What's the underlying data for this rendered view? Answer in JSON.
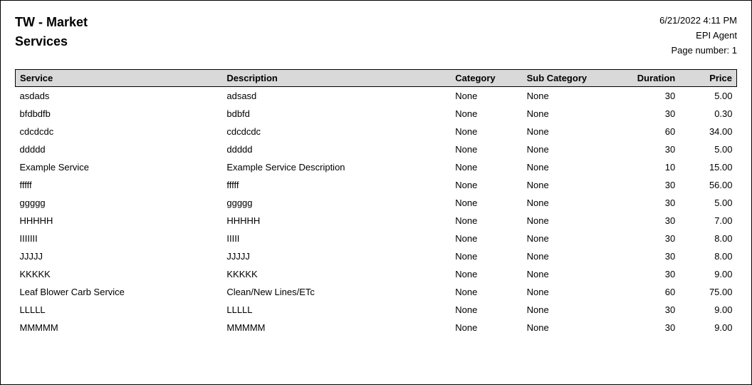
{
  "header": {
    "title_line1": "TW - Market",
    "title_line2": "Services",
    "datetime": "6/21/2022 4:11 PM",
    "agent": "EPI Agent",
    "page_label": "Page number: 1"
  },
  "table": {
    "columns": {
      "service": "Service",
      "description": "Description",
      "category": "Category",
      "subcategory": "Sub Category",
      "duration": "Duration",
      "price": "Price"
    },
    "rows": [
      {
        "service": "asdads",
        "description": "adsasd",
        "category": "None",
        "subcategory": "None",
        "duration": "30",
        "price": "5.00"
      },
      {
        "service": "bfdbdfb",
        "description": "bdbfd",
        "category": "None",
        "subcategory": "None",
        "duration": "30",
        "price": "0.30"
      },
      {
        "service": "cdcdcdc",
        "description": "cdcdcdc",
        "category": "None",
        "subcategory": "None",
        "duration": "60",
        "price": "34.00"
      },
      {
        "service": "ddddd",
        "description": "ddddd",
        "category": "None",
        "subcategory": "None",
        "duration": "30",
        "price": "5.00"
      },
      {
        "service": "Example Service",
        "description": "Example Service Description",
        "category": "None",
        "subcategory": "None",
        "duration": "10",
        "price": "15.00"
      },
      {
        "service": "fffff",
        "description": "fffff",
        "category": "None",
        "subcategory": "None",
        "duration": "30",
        "price": "56.00"
      },
      {
        "service": "ggggg",
        "description": "ggggg",
        "category": "None",
        "subcategory": "None",
        "duration": "30",
        "price": "5.00"
      },
      {
        "service": "HHHHH",
        "description": "HHHHH",
        "category": "None",
        "subcategory": "None",
        "duration": "30",
        "price": "7.00"
      },
      {
        "service": "IIIIIII",
        "description": "IIIII",
        "category": "None",
        "subcategory": "None",
        "duration": "30",
        "price": "8.00"
      },
      {
        "service": "JJJJJ",
        "description": "JJJJJ",
        "category": "None",
        "subcategory": "None",
        "duration": "30",
        "price": "8.00"
      },
      {
        "service": "KKKKK",
        "description": "KKKKK",
        "category": "None",
        "subcategory": "None",
        "duration": "30",
        "price": "9.00"
      },
      {
        "service": "Leaf Blower Carb Service",
        "description": "Clean/New Lines/ETc",
        "category": "None",
        "subcategory": "None",
        "duration": "60",
        "price": "75.00"
      },
      {
        "service": "LLLLL",
        "description": "LLLLL",
        "category": "None",
        "subcategory": "None",
        "duration": "30",
        "price": "9.00"
      },
      {
        "service": "MMMMM",
        "description": "MMMMM",
        "category": "None",
        "subcategory": "None",
        "duration": "30",
        "price": "9.00"
      }
    ]
  }
}
